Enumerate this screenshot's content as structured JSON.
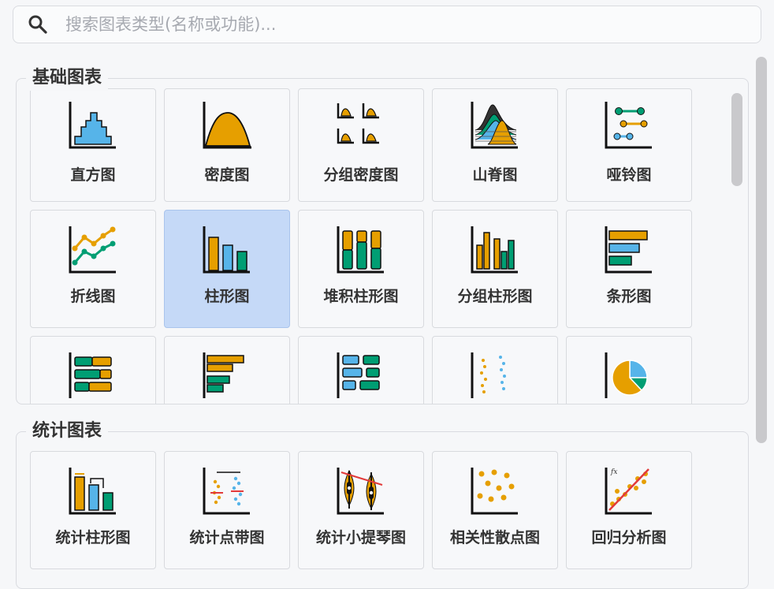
{
  "search": {
    "placeholder": "搜索图表类型(名称或功能)..."
  },
  "groups": [
    {
      "title": "基础图表",
      "items": [
        {
          "label": "直方图"
        },
        {
          "label": "密度图"
        },
        {
          "label": "分组密度图"
        },
        {
          "label": "山脊图"
        },
        {
          "label": "哑铃图"
        },
        {
          "label": "折线图"
        },
        {
          "label": "柱形图",
          "selected": true
        },
        {
          "label": "堆积柱形图"
        },
        {
          "label": "分组柱形图"
        },
        {
          "label": "条形图"
        },
        {
          "label": ""
        },
        {
          "label": ""
        },
        {
          "label": ""
        },
        {
          "label": ""
        },
        {
          "label": ""
        }
      ]
    },
    {
      "title": "统计图表",
      "items": [
        {
          "label": "统计柱形图"
        },
        {
          "label": "统计点带图"
        },
        {
          "label": "统计小提琴图"
        },
        {
          "label": "相关性散点图"
        },
        {
          "label": "回归分析图"
        }
      ]
    }
  ],
  "colors": {
    "orange": "#E69F00",
    "blue": "#56B4E9",
    "green": "#009E73",
    "selected": "#c5d9f7"
  }
}
